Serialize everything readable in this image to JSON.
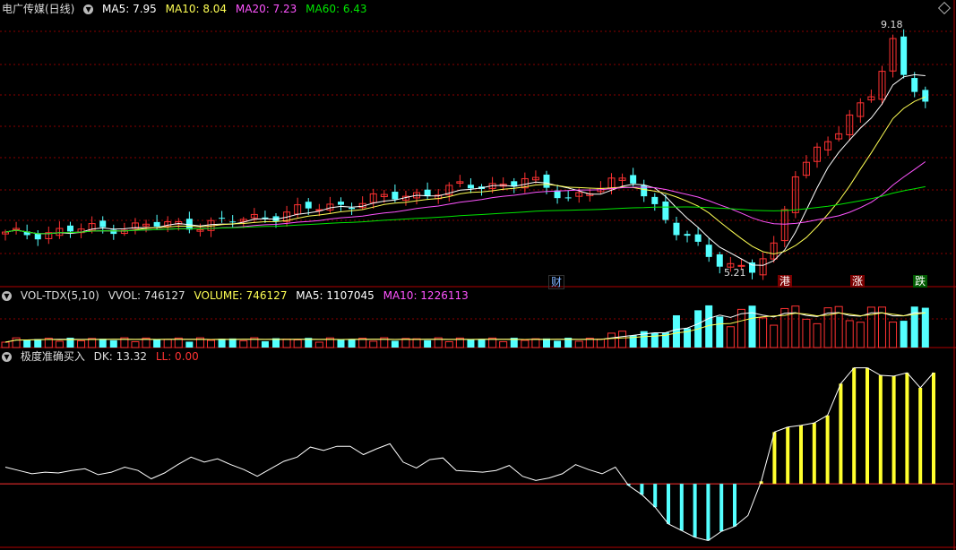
{
  "price_panel": {
    "stock_name": "电广传媒(日线)",
    "ma5_label": "MA5: 7.95",
    "ma10_label": "MA10: 8.04",
    "ma20_label": "MA20: 7.23",
    "ma60_label": "MA60: 6.43",
    "high_label": "9.18",
    "low_label": "5.21",
    "events": [
      "财",
      "港",
      "涨",
      "跌"
    ]
  },
  "volume_panel": {
    "indicator": "VOL-TDX(5,10)",
    "vvol_label": "VVOL: 746127",
    "volume_label": "VOLUME: 746127",
    "ma5_label": "MA5: 1107045",
    "ma10_label": "MA10: 1226113"
  },
  "signal_panel": {
    "indicator": "极度准确买入",
    "dk_label": "DK: 13.32",
    "ll_label": "LL: 0.00"
  },
  "colors": {
    "up": "#ff3232",
    "down": "#54ffff",
    "ma5": "#ffffff",
    "ma10": "#ffff54",
    "ma20": "#ff54ff",
    "ma60": "#00e600",
    "grid": "#8a0000",
    "dk_bar": "#ffff2e",
    "ll_bar": "#54ffff"
  },
  "chart_data": {
    "type": "candlestick",
    "n": 57,
    "close": [
      5.85,
      5.88,
      5.9,
      5.92,
      5.95,
      5.9,
      5.93,
      5.96,
      5.95,
      5.97,
      5.92,
      5.88,
      5.94,
      6.02,
      6.06,
      6.03,
      6.06,
      6.02,
      5.98,
      5.95,
      5.98,
      6.0,
      6.12,
      6.22,
      6.29,
      6.35,
      6.4,
      6.38,
      6.44,
      6.55,
      6.42,
      6.37,
      6.46,
      6.62,
      6.78,
      6.68,
      6.58,
      6.61,
      6.56,
      6.45,
      6.46,
      6.42,
      6.55,
      6.72,
      6.78,
      6.75,
      6.6,
      6.2,
      5.95,
      5.75,
      5.6,
      5.45,
      5.35,
      5.3,
      5.28,
      5.35,
      5.6,
      6.3,
      7.0,
      7.3,
      7.4,
      7.48,
      7.8,
      8.35,
      8.85,
      8.5,
      8.2,
      8.55,
      8.3,
      8.25,
      8.5,
      8.1,
      7.5
    ],
    "dk": [
      2.0,
      1.6,
      1.2,
      1.4,
      1.3,
      1.6,
      1.8,
      1.1,
      1.4,
      2.0,
      1.6,
      0.6,
      1.3,
      2.3,
      3.2,
      2.6,
      3.0,
      2.3,
      1.7,
      0.9,
      1.8,
      2.7,
      3.2,
      4.4,
      4.0,
      4.5,
      4.5,
      3.5,
      4.2,
      4.8,
      2.6,
      1.9,
      2.9,
      3.1,
      1.6,
      1.5,
      1.4,
      1.6,
      2.2,
      0.9,
      0.4,
      0.7,
      1.2,
      2.3,
      1.7,
      1.2,
      2.0,
      -0.2,
      -1.3,
      -2.8,
      -4.8,
      -5.6,
      -6.4,
      -6.8,
      -5.7,
      -5.1,
      -3.8,
      0.3,
      6.2,
      6.8,
      7.0,
      7.3,
      8.2,
      12.0,
      13.9,
      13.9,
      13.0,
      12.9,
      13.3,
      11.5,
      13.32
    ],
    "ll": [
      0,
      0,
      0,
      0,
      0,
      0,
      0,
      0,
      0,
      0,
      0,
      0,
      0,
      0,
      0,
      0,
      0,
      0,
      0,
      0,
      0,
      0,
      0,
      0,
      0,
      0,
      0,
      0,
      0,
      0,
      0,
      0,
      0,
      0,
      0,
      0,
      0,
      0,
      0,
      0,
      0,
      0,
      0,
      0,
      0,
      0,
      0,
      0,
      0,
      0,
      0,
      0,
      0,
      0,
      0,
      0,
      0,
      0,
      0,
      0,
      0,
      0,
      0,
      0,
      0,
      0,
      0,
      0,
      0,
      0,
      0
    ]
  }
}
